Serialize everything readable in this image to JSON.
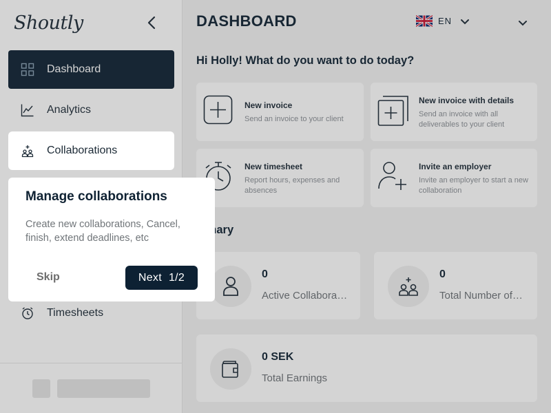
{
  "app": {
    "logo": "Shoutly"
  },
  "sidebar": {
    "items": [
      {
        "label": "Dashboard"
      },
      {
        "label": "Analytics"
      },
      {
        "label": "Collaborations"
      },
      {
        "label": "Timesheets"
      }
    ]
  },
  "header": {
    "title": "DASHBOARD",
    "language": "EN"
  },
  "greeting": "Hi Holly! What do you want to do today?",
  "actions": [
    {
      "title": "New invoice",
      "desc": "Send an invoice to your client"
    },
    {
      "title": "New invoice with details",
      "desc": "Send an invoice with all deliverables to your client"
    },
    {
      "title": "New timesheet",
      "desc": "Report hours, expenses and absences"
    },
    {
      "title": "Invite an employer",
      "desc": "Invite an employer to start a new collaboration"
    }
  ],
  "summary": {
    "title": "Summary",
    "title_visible": "mmary",
    "stats": [
      {
        "value": "0",
        "label": "Active Collaborations"
      },
      {
        "value": "0",
        "label": "Total Number of Collaborations"
      },
      {
        "value": "0 SEK",
        "label": "Total Earnings"
      }
    ]
  },
  "tour": {
    "title": "Manage collaborations",
    "description": "Create new collaborations, Cancel, finish, extend deadlines, etc",
    "skip_label": "Skip",
    "next_label": "Next",
    "step": "1/2"
  },
  "colors": {
    "primary": "#0d2133",
    "background": "#f2f2f2",
    "card": "#ffffff"
  }
}
